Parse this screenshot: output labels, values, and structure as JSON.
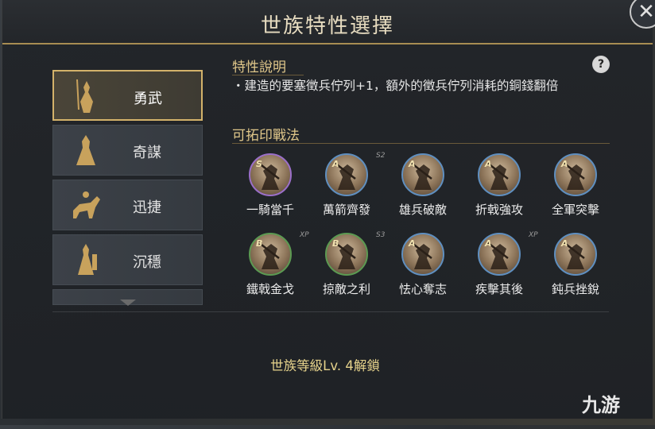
{
  "dialog": {
    "title": "世族特性選擇",
    "close_icon": "close-icon"
  },
  "sidebar": {
    "items": [
      {
        "label": "勇武",
        "icon": "warrior-icon",
        "active": true
      },
      {
        "label": "奇謀",
        "icon": "strategist-icon",
        "active": false
      },
      {
        "label": "迅捷",
        "icon": "cavalry-icon",
        "active": false
      },
      {
        "label": "沉穩",
        "icon": "guardian-icon",
        "active": false
      }
    ]
  },
  "trait": {
    "section_title": "特性說明",
    "description": "・建造的要塞徵兵佇列+1，額外的徵兵佇列消耗的銅錢翻倍"
  },
  "skills": {
    "section_title": "可拓印戰法",
    "items": [
      {
        "name": "一騎當千",
        "grade": "S",
        "tag": "",
        "ring": "#9b6fc9"
      },
      {
        "name": "萬箭齊發",
        "grade": "A",
        "tag": "S2",
        "ring": "#5f8fc0"
      },
      {
        "name": "雄兵破敵",
        "grade": "A",
        "tag": "",
        "ring": "#5f8fc0"
      },
      {
        "name": "折戟強攻",
        "grade": "A",
        "tag": "",
        "ring": "#5f8fc0"
      },
      {
        "name": "全軍突擊",
        "grade": "A",
        "tag": "",
        "ring": "#5f8fc0"
      },
      {
        "name": "鐵戟金戈",
        "grade": "B",
        "tag": "XP",
        "ring": "#5c9a52"
      },
      {
        "name": "掠敵之利",
        "grade": "B",
        "tag": "S3",
        "ring": "#5c9a52"
      },
      {
        "name": "怯心奪志",
        "grade": "A",
        "tag": "",
        "ring": "#5f8fc0"
      },
      {
        "name": "疾擊其後",
        "grade": "A",
        "tag": "XP",
        "ring": "#5f8fc0"
      },
      {
        "name": "鈍兵挫銳",
        "grade": "A",
        "tag": "",
        "ring": "#5f8fc0"
      }
    ]
  },
  "footer": {
    "unlock_text": "世族等級Lv. 4解鎖"
  },
  "watermark": {
    "text": "九游"
  }
}
